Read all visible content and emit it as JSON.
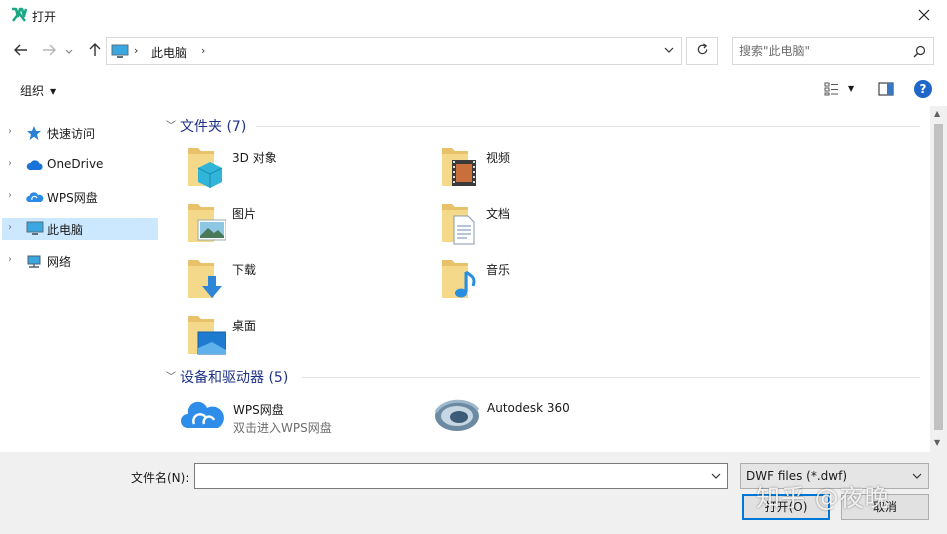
{
  "window": {
    "title": "打开",
    "app_icon": "wps-app-icon",
    "close_glyph": "✕"
  },
  "address_bar": {
    "location_icon": "this-pc-icon",
    "breadcrumb": [
      "此电脑"
    ],
    "separator": "›"
  },
  "search": {
    "placeholder": "搜索\"此电脑\""
  },
  "toolbar": {
    "organize_label": "组织",
    "help_label": "?"
  },
  "nav_pane": {
    "items": [
      {
        "label": "快速访问",
        "icon": "star-icon"
      },
      {
        "label": "OneDrive",
        "icon": "cloud-icon"
      },
      {
        "label": "WPS网盘",
        "icon": "wps-cloud-icon"
      },
      {
        "label": "此电脑",
        "icon": "this-pc-icon",
        "selected": true
      },
      {
        "label": "网络",
        "icon": "network-icon"
      }
    ]
  },
  "content": {
    "folders_group": {
      "title": "文件夹 (7)",
      "items": [
        {
          "label": "3D 对象",
          "icon": "3d-objects-folder-icon"
        },
        {
          "label": "视频",
          "icon": "videos-folder-icon"
        },
        {
          "label": "图片",
          "icon": "pictures-folder-icon"
        },
        {
          "label": "文档",
          "icon": "documents-folder-icon"
        },
        {
          "label": "下载",
          "icon": "downloads-folder-icon"
        },
        {
          "label": "音乐",
          "icon": "music-folder-icon"
        },
        {
          "label": "桌面",
          "icon": "desktop-folder-icon"
        }
      ]
    },
    "devices_group": {
      "title": "设备和驱动器 (5)",
      "items": [
        {
          "label": "WPS网盘",
          "sublabel": "双击进入WPS网盘",
          "icon": "wps-cloud-drive-icon"
        },
        {
          "label": "Autodesk 360",
          "icon": "autodesk-360-icon"
        }
      ]
    }
  },
  "bottom": {
    "filename_label": "文件名(N):",
    "filename_value": "",
    "file_type": "DWF files (*.dwf)",
    "open_label": "打开(O)",
    "cancel_label": "取消",
    "watermark": "知乎 @夜晚"
  }
}
